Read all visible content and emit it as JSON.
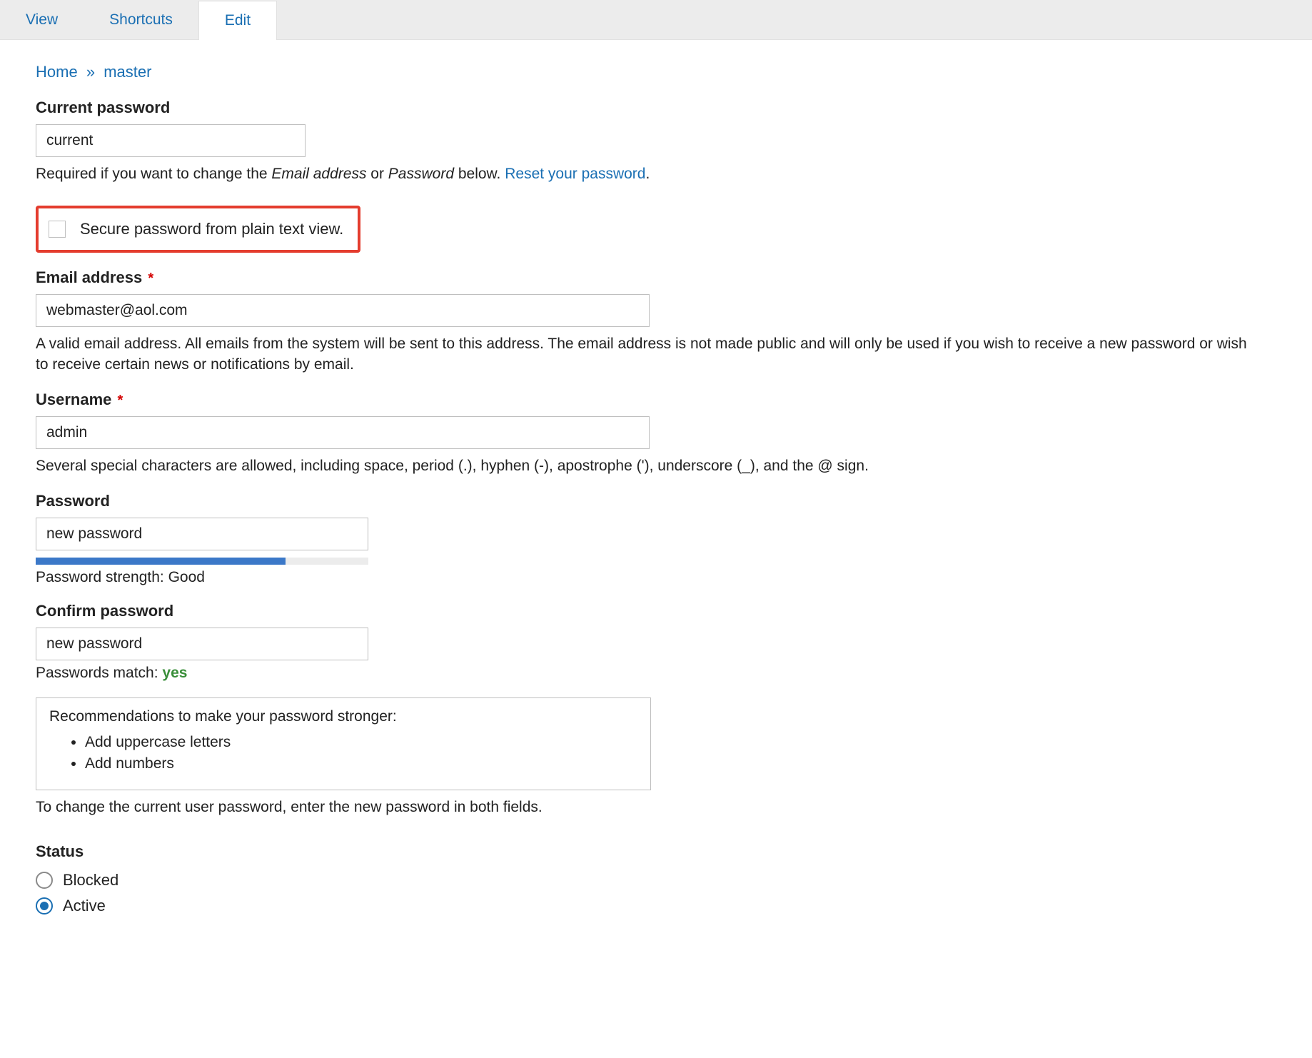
{
  "tabs": {
    "view": "View",
    "shortcuts": "Shortcuts",
    "edit": "Edit",
    "active": "edit"
  },
  "breadcrumb": {
    "home": "Home",
    "sep": "»",
    "current": "master"
  },
  "current_password": {
    "label": "Current password",
    "value": "current",
    "help_prefix": "Required if you want to change the ",
    "help_em1": "Email address",
    "help_mid": " or ",
    "help_em2": "Password",
    "help_suffix": " below. ",
    "reset_link": "Reset your password",
    "period": "."
  },
  "secure_checkbox": {
    "label": "Secure password from plain text view.",
    "checked": false
  },
  "email": {
    "label": "Email address",
    "value": "webmaster@aol.com",
    "help": "A valid email address. All emails from the system will be sent to this address. The email address is not made public and will only be used if you wish to receive a new password or wish to receive certain news or notifications by email."
  },
  "username": {
    "label": "Username",
    "value": "admin",
    "help": "Several special characters are allowed, including space, period (.), hyphen (-), apostrophe ('), underscore (_), and the @ sign."
  },
  "password": {
    "label": "Password",
    "value": "new password",
    "strength_percent": 75,
    "strength_prefix": "Password strength: ",
    "strength_text": "Good"
  },
  "confirm": {
    "label": "Confirm password",
    "value": "new password",
    "match_prefix": "Passwords match: ",
    "match_text": "yes"
  },
  "recommendations": {
    "title": "Recommendations to make your password stronger:",
    "items": [
      "Add uppercase letters",
      "Add numbers"
    ],
    "footer": "To change the current user password, enter the new password in both fields."
  },
  "status": {
    "label": "Status",
    "options": [
      {
        "key": "blocked",
        "label": "Blocked",
        "selected": false
      },
      {
        "key": "active",
        "label": "Active",
        "selected": true
      }
    ]
  }
}
